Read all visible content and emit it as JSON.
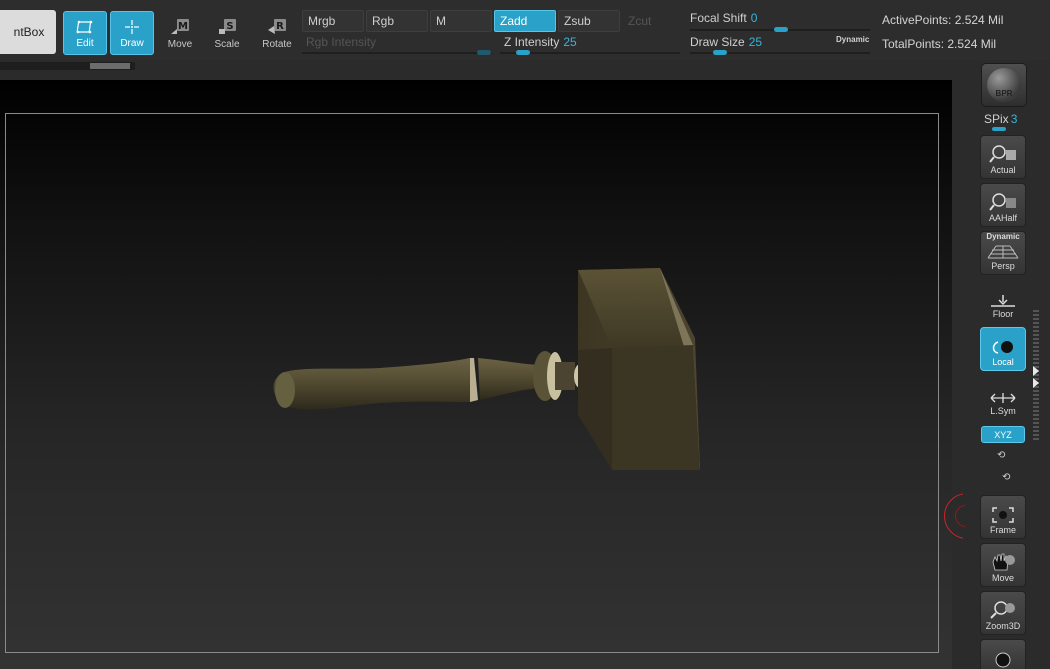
{
  "toolbar": {
    "lightbox_label": "ntBox",
    "edit_label": "Edit",
    "draw_label": "Draw",
    "move_label": "Move",
    "scale_label": "Scale",
    "rotate_label": "Rotate",
    "move_key": "M",
    "scale_key": "S",
    "rotate_key": "R",
    "modes": {
      "mrgb": "Mrgb",
      "rgb": "Rgb",
      "m": "M",
      "zadd": "Zadd",
      "zsub": "Zsub",
      "zcut": "Zcut"
    },
    "rgb_intensity_label": "Rgb Intensity",
    "z_intensity": {
      "label": "Z Intensity",
      "value": "25",
      "level": 0.25
    },
    "focal_shift": {
      "label": "Focal Shift",
      "value": "0",
      "level": 0.0
    },
    "draw_size": {
      "label": "Draw Size",
      "value": "25",
      "level": 0.05
    },
    "dynamic_label": "Dynamic",
    "active_points": "ActivePoints: 2.524 Mil",
    "total_points": "TotalPoints: 2.524 Mil"
  },
  "shelf": {
    "bpr_label": "BPR",
    "spix_label": "SPix",
    "spix_value": "3",
    "actual_label": "Actual",
    "aahalf_label": "AAHalf",
    "persp_label": "Persp",
    "persp_dynamic": "Dynamic",
    "floor_label": "Floor",
    "local_label": "Local",
    "lsym_label": "L.Sym",
    "xyz_label": "XYZ",
    "frame_label": "Frame",
    "move_label": "Move",
    "zoom3d_label": "Zoom3D"
  },
  "colors": {
    "accent": "#2aa1c8",
    "background": "#2b2b2b",
    "gizmo": "#c0262b",
    "model": "#5b5238"
  },
  "icons": {
    "edit": "edit-frame-icon",
    "draw": "draw-crosshair-icon",
    "move": "move-icon",
    "scale": "scale-icon",
    "rotate": "rotate-icon"
  }
}
